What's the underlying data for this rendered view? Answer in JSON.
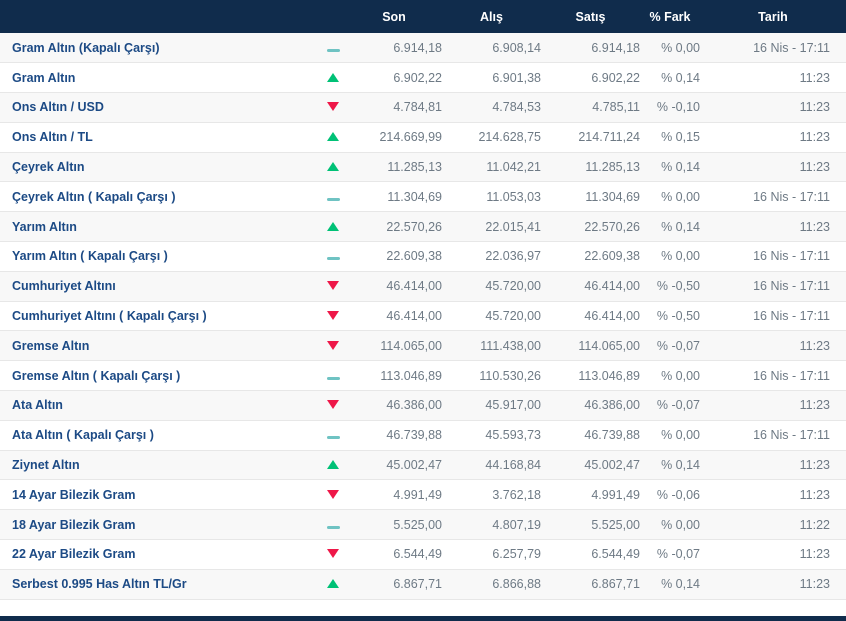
{
  "colors": {
    "header_bg": "#102c4c",
    "name_text": "#1c4a85",
    "value_text": "#6e7a85",
    "up": "#00c176",
    "down": "#ee1748",
    "flat": "#6fc3c3",
    "row_alt_bg": "#f8f8f8",
    "border": "#e7e7e7"
  },
  "table": {
    "headers": {
      "name": "",
      "son": "Son",
      "alis": "Alış",
      "satis": "Satış",
      "fark": "% Fark",
      "tarih": "Tarih"
    },
    "rows": [
      {
        "name": "Gram Altın (Kapalı Çarşı)",
        "trend": "flat",
        "son": "6.914,18",
        "alis": "6.908,14",
        "satis": "6.914,18",
        "fark": "% 0,00",
        "tarih": "16 Nis - 17:11"
      },
      {
        "name": "Gram Altın",
        "trend": "up",
        "son": "6.902,22",
        "alis": "6.901,38",
        "satis": "6.902,22",
        "fark": "% 0,14",
        "tarih": "11:23"
      },
      {
        "name": "Ons Altın / USD",
        "trend": "down",
        "son": "4.784,81",
        "alis": "4.784,53",
        "satis": "4.785,11",
        "fark": "% -0,10",
        "tarih": "11:23"
      },
      {
        "name": "Ons Altın / TL",
        "trend": "up",
        "son": "214.669,99",
        "alis": "214.628,75",
        "satis": "214.711,24",
        "fark": "% 0,15",
        "tarih": "11:23"
      },
      {
        "name": "Çeyrek Altın",
        "trend": "up",
        "son": "11.285,13",
        "alis": "11.042,21",
        "satis": "11.285,13",
        "fark": "% 0,14",
        "tarih": "11:23"
      },
      {
        "name": "Çeyrek Altın ( Kapalı Çarşı )",
        "trend": "flat",
        "son": "11.304,69",
        "alis": "11.053,03",
        "satis": "11.304,69",
        "fark": "% 0,00",
        "tarih": "16 Nis - 17:11"
      },
      {
        "name": "Yarım Altın",
        "trend": "up",
        "son": "22.570,26",
        "alis": "22.015,41",
        "satis": "22.570,26",
        "fark": "% 0,14",
        "tarih": "11:23"
      },
      {
        "name": "Yarım Altın ( Kapalı Çarşı )",
        "trend": "flat",
        "son": "22.609,38",
        "alis": "22.036,97",
        "satis": "22.609,38",
        "fark": "% 0,00",
        "tarih": "16 Nis - 17:11"
      },
      {
        "name": "Cumhuriyet Altını",
        "trend": "down",
        "son": "46.414,00",
        "alis": "45.720,00",
        "satis": "46.414,00",
        "fark": "% -0,50",
        "tarih": "16 Nis - 17:11"
      },
      {
        "name": "Cumhuriyet Altını ( Kapalı Çarşı )",
        "trend": "down",
        "son": "46.414,00",
        "alis": "45.720,00",
        "satis": "46.414,00",
        "fark": "% -0,50",
        "tarih": "16 Nis - 17:11"
      },
      {
        "name": "Gremse Altın",
        "trend": "down",
        "son": "114.065,00",
        "alis": "111.438,00",
        "satis": "114.065,00",
        "fark": "% -0,07",
        "tarih": "11:23"
      },
      {
        "name": "Gremse Altın ( Kapalı Çarşı )",
        "trend": "flat",
        "son": "113.046,89",
        "alis": "110.530,26",
        "satis": "113.046,89",
        "fark": "% 0,00",
        "tarih": "16 Nis - 17:11"
      },
      {
        "name": "Ata Altın",
        "trend": "down",
        "son": "46.386,00",
        "alis": "45.917,00",
        "satis": "46.386,00",
        "fark": "% -0,07",
        "tarih": "11:23"
      },
      {
        "name": "Ata Altın ( Kapalı Çarşı )",
        "trend": "flat",
        "son": "46.739,88",
        "alis": "45.593,73",
        "satis": "46.739,88",
        "fark": "% 0,00",
        "tarih": "16 Nis - 17:11"
      },
      {
        "name": "Ziynet Altın",
        "trend": "up",
        "son": "45.002,47",
        "alis": "44.168,84",
        "satis": "45.002,47",
        "fark": "% 0,14",
        "tarih": "11:23"
      },
      {
        "name": "14 Ayar Bilezik Gram",
        "trend": "down",
        "son": "4.991,49",
        "alis": "3.762,18",
        "satis": "4.991,49",
        "fark": "% -0,06",
        "tarih": "11:23"
      },
      {
        "name": "18 Ayar Bilezik Gram",
        "trend": "flat",
        "son": "5.525,00",
        "alis": "4.807,19",
        "satis": "5.525,00",
        "fark": "% 0,00",
        "tarih": "11:22"
      },
      {
        "name": "22 Ayar Bilezik Gram",
        "trend": "down",
        "son": "6.544,49",
        "alis": "6.257,79",
        "satis": "6.544,49",
        "fark": "% -0,07",
        "tarih": "11:23"
      },
      {
        "name": "Serbest 0.995 Has Altın TL/Gr",
        "trend": "up",
        "son": "6.867,71",
        "alis": "6.866,88",
        "satis": "6.867,71",
        "fark": "% 0,14",
        "tarih": "11:23"
      }
    ]
  }
}
